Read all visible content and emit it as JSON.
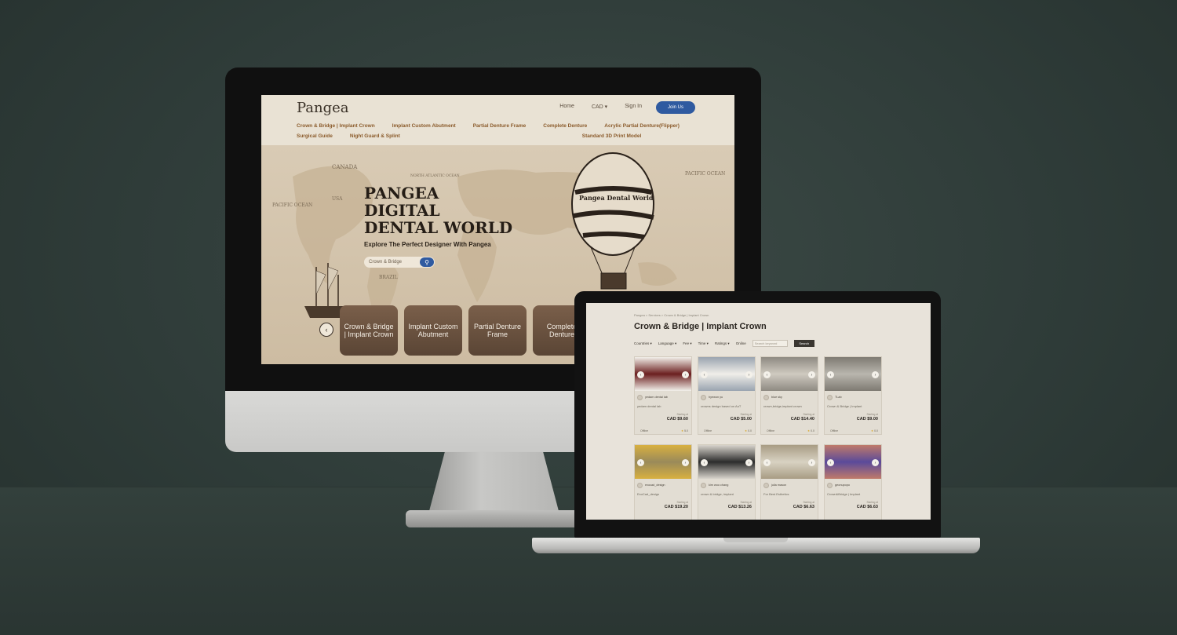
{
  "desktop_site": {
    "logo": "Pangea",
    "topnav": {
      "home": "Home",
      "cad": "CAD ▾",
      "sign_in": "Sign In",
      "join": "Join Us"
    },
    "categories": [
      "Crown & Bridge | Implant Crown",
      "Implant Custom Abutment",
      "Partial Denture Frame",
      "Complete Denture",
      "Acrylic Partial Denture(Flipper)",
      "Surgical Guide",
      "Night Guard & Splint",
      "Standard 3D Print Model"
    ],
    "hero": {
      "title_line1": "PANGEA",
      "title_line2": "DIGITAL",
      "title_line3": "DENTAL WORLD",
      "subtitle": "Explore The Perfect Designer With Pangea",
      "search_value": "Crown & Bridge",
      "search_icon": "search-icon",
      "balloon_text": "Pangea Dental World",
      "cards": [
        "Crown & Bridge | Implant Crown",
        "Implant Custom Abutment",
        "Partial Denture Frame",
        "Complete Denture"
      ]
    },
    "map_labels": [
      "PACIFIC OCEAN",
      "PACIFIC OCEAN",
      "NORTH ATLANTIC OCEAN",
      "CANADA",
      "USA",
      "BRAZIL"
    ]
  },
  "laptop_site": {
    "breadcrumb": "Pangea > Services > Crown & Bridge | Implant Crown",
    "title": "Crown & Bridge | Implant Crown",
    "filters": {
      "countries": "Countries ▾",
      "language": "Language ▾",
      "fee": "Fee ▾",
      "time": "Time ▾",
      "ratings": "Ratings ▾",
      "online": "Online",
      "search_placeholder": "Search keyword",
      "search_button": "Search"
    },
    "products": [
      {
        "seller": "yedam dental lab",
        "desc": "yedam dental lab",
        "starting": "Starting at",
        "price": "CAD $9.60",
        "status": "Offline",
        "rating": "5.0"
      },
      {
        "seller": "hyewon yu",
        "desc": "crowns design based on AoT",
        "starting": "Starting at",
        "price": "CAD $5.00",
        "status": "Offline",
        "rating": "0.0"
      },
      {
        "seller": "blue sky",
        "desc": "crown,bridge,implant crown",
        "starting": "Starting at",
        "price": "CAD $14.40",
        "status": "Offline",
        "rating": "0.0"
      },
      {
        "seller": "TLab",
        "desc": "Crown & Bridge | Implant",
        "starting": "Starting at",
        "price": "CAD $9.00",
        "status": "Offline",
        "rating": "0.0"
      },
      {
        "seller": "exocad_design",
        "desc": "ExoCad_design",
        "starting": "Starting at",
        "price": "CAD $19.20",
        "status": "",
        "rating": ""
      },
      {
        "seller": "kim woo chang",
        "desc": "crown & bridge, implant",
        "starting": "Starting at",
        "price": "CAD $13.26",
        "status": "",
        "rating": ""
      },
      {
        "seller": "julia mason",
        "desc": "For Best Esthetics",
        "starting": "Starting at",
        "price": "CAD $6.63",
        "status": "",
        "rating": ""
      },
      {
        "seller": "geonupopo",
        "desc": "Crown&Bridge | Implant",
        "starting": "Starting at",
        "price": "CAD $6.63",
        "status": "",
        "rating": ""
      }
    ]
  }
}
